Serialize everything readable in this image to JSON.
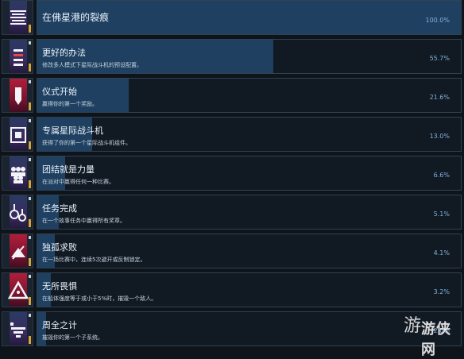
{
  "achievements": [
    {
      "title": "在佛星港的裂痕",
      "desc": "",
      "pct": "100.0%",
      "progress": 1.0,
      "icon": "ladder-stripes-icon"
    },
    {
      "title": "更好的办法",
      "desc": "修改多人模式下星际战斗机的预设配置。",
      "pct": "55.7%",
      "progress": 0.557,
      "icon": "banner-stripes-icon"
    },
    {
      "title": "仪式开始",
      "desc": "赢得你的第一个奖励。",
      "pct": "21.6%",
      "progress": 0.216,
      "icon": "ribbon-icon"
    },
    {
      "title": "专属星际战斗机",
      "desc": "获得了你的第一个星际战斗机组件。",
      "pct": "13.0%",
      "progress": 0.13,
      "icon": "starfighter-module-icon"
    },
    {
      "title": "团结就是力量",
      "desc": "在派对中赢得任何一种比赛。",
      "pct": "6.6%",
      "progress": 0.066,
      "icon": "group-icon"
    },
    {
      "title": "任务完成",
      "desc": "在一个故事任务中赢得所有奖章。",
      "pct": "5.1%",
      "progress": 0.051,
      "icon": "medals-icon"
    },
    {
      "title": "独孤求败",
      "desc": "在一场比赛中，连续5次避开或反制锁定。",
      "pct": "4.1%",
      "progress": 0.041,
      "icon": "lone-ship-icon"
    },
    {
      "title": "无所畏惧",
      "desc": "在船体强度等于或小于5%时，摧毁一个敌人。",
      "pct": "3.2%",
      "progress": 0.032,
      "icon": "triangle-icon"
    },
    {
      "title": "周全之计",
      "desc": "摧毁你的第一个子系统。",
      "pct": "2.0%",
      "progress": 0.02,
      "icon": "subsystem-icon"
    }
  ],
  "watermark": {
    "text": "游侠网",
    "logo": "游"
  }
}
